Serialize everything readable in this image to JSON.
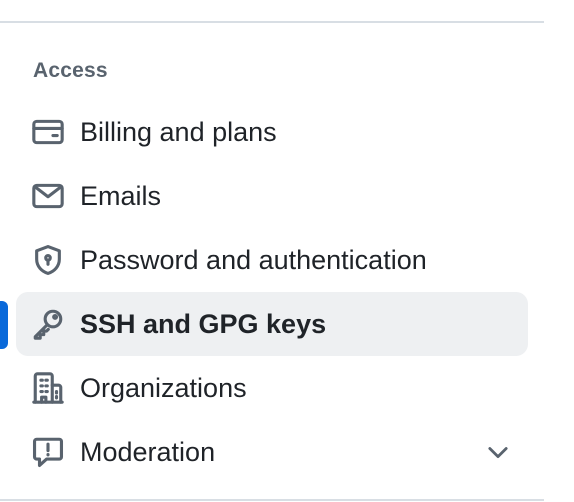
{
  "sidebar": {
    "section_heading": "Access",
    "active_color": "#0969da",
    "items": [
      {
        "label": "Billing and plans",
        "icon": "credit-card-icon",
        "active": false
      },
      {
        "label": "Emails",
        "icon": "mail-icon",
        "active": false
      },
      {
        "label": "Password and authentication",
        "icon": "shield-lock-icon",
        "active": false
      },
      {
        "label": "SSH and GPG keys",
        "icon": "key-icon",
        "active": true
      },
      {
        "label": "Organizations",
        "icon": "organization-icon",
        "active": false
      },
      {
        "label": "Moderation",
        "icon": "report-icon",
        "active": false,
        "expandable": true
      }
    ]
  }
}
